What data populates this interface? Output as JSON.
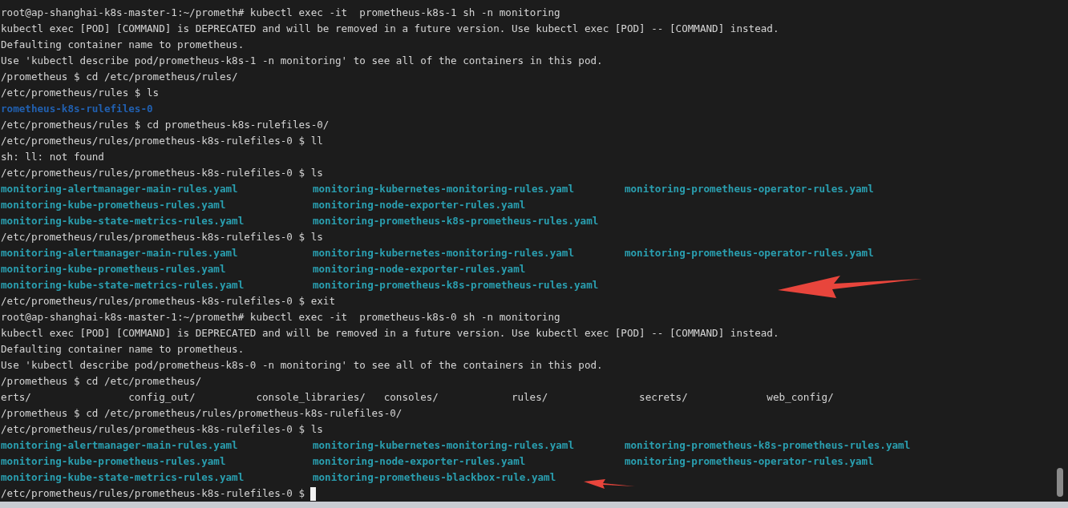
{
  "terminal": {
    "lines": [
      {
        "kind": "plain",
        "text": "root@ap-shanghai-k8s-master-1:~/prometh# kubectl exec -it  prometheus-k8s-1 sh -n monitoring"
      },
      {
        "kind": "plain",
        "text": "kubectl exec [POD] [COMMAND] is DEPRECATED and will be removed in a future version. Use kubectl exec [POD] -- [COMMAND] instead."
      },
      {
        "kind": "plain",
        "text": "Defaulting container name to prometheus."
      },
      {
        "kind": "plain",
        "text": "Use 'kubectl describe pod/prometheus-k8s-1 -n monitoring' to see all of the containers in this pod."
      },
      {
        "kind": "plain",
        "text": "/prometheus $ cd /etc/prometheus/rules/"
      },
      {
        "kind": "plain",
        "text": "/etc/prometheus/rules $ ls"
      },
      {
        "kind": "dir",
        "text": "rometheus-k8s-rulefiles-0"
      },
      {
        "kind": "plain",
        "text": "/etc/prometheus/rules $ cd prometheus-k8s-rulefiles-0/"
      },
      {
        "kind": "plain",
        "text": "/etc/prometheus/rules/prometheus-k8s-rulefiles-0 $ ll"
      },
      {
        "kind": "plain",
        "text": "sh: ll: not found"
      },
      {
        "kind": "plain",
        "text": "/etc/prometheus/rules/prometheus-k8s-rulefiles-0 $ ls"
      },
      {
        "kind": "files",
        "cells": [
          "monitoring-alertmanager-main-rules.yaml",
          "monitoring-kubernetes-monitoring-rules.yaml",
          "monitoring-prometheus-operator-rules.yaml"
        ]
      },
      {
        "kind": "files",
        "cells": [
          "monitoring-kube-prometheus-rules.yaml",
          "monitoring-node-exporter-rules.yaml"
        ]
      },
      {
        "kind": "files",
        "cells": [
          "monitoring-kube-state-metrics-rules.yaml",
          "monitoring-prometheus-k8s-prometheus-rules.yaml"
        ]
      },
      {
        "kind": "plain",
        "text": "/etc/prometheus/rules/prometheus-k8s-rulefiles-0 $ ls"
      },
      {
        "kind": "files",
        "cells": [
          "monitoring-alertmanager-main-rules.yaml",
          "monitoring-kubernetes-monitoring-rules.yaml",
          "monitoring-prometheus-operator-rules.yaml"
        ]
      },
      {
        "kind": "files",
        "cells": [
          "monitoring-kube-prometheus-rules.yaml",
          "monitoring-node-exporter-rules.yaml"
        ]
      },
      {
        "kind": "files",
        "cells": [
          "monitoring-kube-state-metrics-rules.yaml",
          "monitoring-prometheus-k8s-prometheus-rules.yaml"
        ]
      },
      {
        "kind": "plain",
        "text": "/etc/prometheus/rules/prometheus-k8s-rulefiles-0 $ exit"
      },
      {
        "kind": "plain",
        "text": "root@ap-shanghai-k8s-master-1:~/prometh# kubectl exec -it  prometheus-k8s-0 sh -n monitoring"
      },
      {
        "kind": "plain",
        "text": "kubectl exec [POD] [COMMAND] is DEPRECATED and will be removed in a future version. Use kubectl exec [POD] -- [COMMAND] instead."
      },
      {
        "kind": "plain",
        "text": "Defaulting container name to prometheus."
      },
      {
        "kind": "plain",
        "text": "Use 'kubectl describe pod/prometheus-k8s-0 -n monitoring' to see all of the containers in this pod."
      },
      {
        "kind": "plain",
        "text": "/prometheus $ cd /etc/prometheus/"
      },
      {
        "kind": "dirs",
        "cells": [
          "erts/",
          "config_out/",
          "console_libraries/",
          "consoles/",
          "rules/",
          "secrets/",
          "web_config/"
        ]
      },
      {
        "kind": "plain",
        "text": "/prometheus $ cd /etc/prometheus/rules/prometheus-k8s-rulefiles-0/"
      },
      {
        "kind": "plain",
        "text": "/etc/prometheus/rules/prometheus-k8s-rulefiles-0 $ ls"
      },
      {
        "kind": "files",
        "cells": [
          "monitoring-alertmanager-main-rules.yaml",
          "monitoring-kubernetes-monitoring-rules.yaml",
          "monitoring-prometheus-k8s-prometheus-rules.yaml"
        ]
      },
      {
        "kind": "files",
        "cells": [
          "monitoring-kube-prometheus-rules.yaml",
          "monitoring-node-exporter-rules.yaml",
          "monitoring-prometheus-operator-rules.yaml"
        ]
      },
      {
        "kind": "files",
        "cells": [
          "monitoring-kube-state-metrics-rules.yaml",
          "monitoring-prometheus-blackbox-rule.yaml"
        ]
      },
      {
        "kind": "prompt",
        "text": "/etc/prometheus/rules/prometheus-k8s-rulefiles-0 $",
        "cursor": true
      }
    ]
  }
}
